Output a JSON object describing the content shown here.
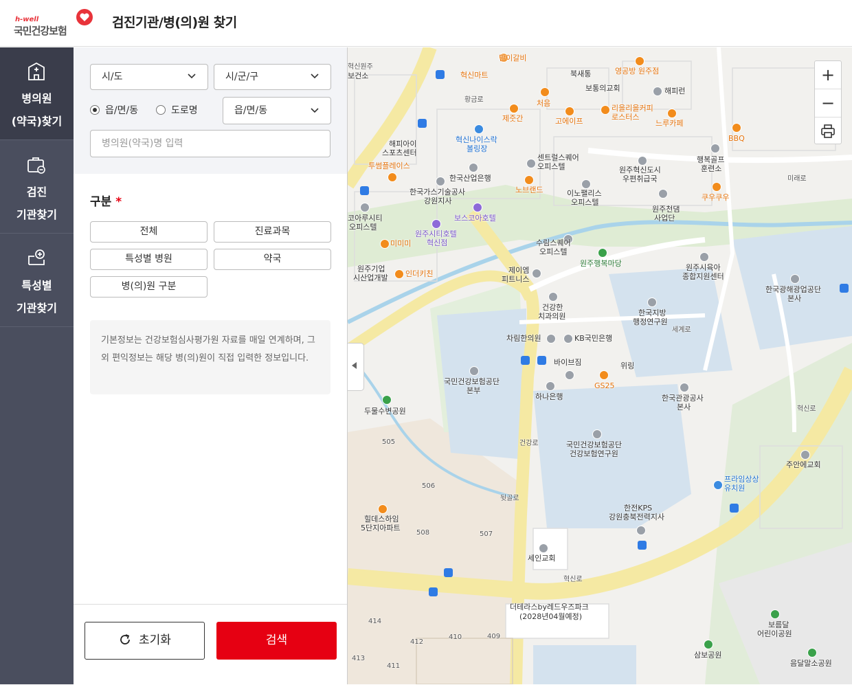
{
  "header": {
    "logo_small": "h-well",
    "logo_name": "국민건강보험",
    "title": "검진기관/병(의)원 찾기"
  },
  "nav": {
    "items": [
      {
        "label": "병의원\n(약국)찾기",
        "line1": "병의원",
        "line2": "(약국)찾기",
        "icon": "hospital-icon",
        "active": true
      },
      {
        "label": "검진\n기관찾기",
        "line1": "검진",
        "line2": "기관찾기",
        "icon": "medical-bag-icon",
        "active": false
      },
      {
        "label": "특성별\n기관찾기",
        "line1": "특성별",
        "line2": "기관찾기",
        "icon": "special-clinic-icon",
        "active": false
      }
    ]
  },
  "filters": {
    "sido": "시/도",
    "sigungu": "시/군/구",
    "radio_eup": "읍/면/동",
    "radio_road": "도로명",
    "eup_select": "읍/면/동",
    "name_placeholder": "병의원(약국)명 입력"
  },
  "category": {
    "title": "구분",
    "required_mark": "*",
    "chips": [
      "전체",
      "진료과목",
      "특성별 병원",
      "약국",
      "병(의)원 구분"
    ]
  },
  "info_text": "기본정보는 건강보험심사평가원 자료를 매일 연계하며, 그 외 편익정보는 해당 병(의)원이 직접 입력한 정보입니다.",
  "actions": {
    "reset": "초기화",
    "search": "검색"
  },
  "map": {
    "labels": [
      "만이갈비",
      "혁신마트",
      "혁신원주",
      "보건소",
      "북새통",
      "보통의교회",
      "영공방 원주점",
      "해피런",
      "처음",
      "제줏간",
      "고에이프",
      "리을리을커피",
      "로스터스",
      "느루카페",
      "BBQ",
      "황금로",
      "혁신나이스락",
      "볼링장",
      "해피아이",
      "스포츠센터",
      "투썸플레이스",
      "한국산업은행",
      "한국가스기술공사",
      "강원지사",
      "센트럴스퀘어",
      "오피스텔",
      "노브랜드",
      "이노팰리스",
      "오피스텔",
      "원주혁신도시",
      "우편취급국",
      "행복골프",
      "훈련소",
      "쿠우쿠우",
      "원주천댐",
      "사업단",
      "미래로",
      "보스코아호텔",
      "코아루시티",
      "오피스텔",
      "원주시티호텔",
      "혁신점",
      "미미미",
      "원주기업",
      "시산업개발",
      "인더키친",
      "수림스퀘어",
      "오피스텔",
      "원주행복마당",
      "제이엠",
      "피트니스",
      "원주시육아",
      "종합지원센터",
      "한국광해광업공단",
      "본사",
      "건강한",
      "치과의원",
      "한국지방",
      "행정연구원",
      "차림한의원",
      "KB국민은행",
      "세계로",
      "국민건강보험공단",
      "본부",
      "바이브짐",
      "위링",
      "GS25",
      "하나은행",
      "한국관광공사",
      "본사",
      "두물수변공원",
      "혁신로",
      "주안에교회",
      "국민건강보험공단",
      "건강보험연구원",
      "건강로",
      "프라임상상",
      "유치원",
      "한전KPS",
      "강원충북전력지사",
      "힐데스하임",
      "5단지아파트",
      "뒷골로",
      "세인교회",
      "혁신로",
      "더테라스by레드우즈파크",
      "(2028년04월예정)",
      "보름달",
      "어린이공원",
      "삼보공원",
      "음달말소공원"
    ],
    "numbers": [
      "505",
      "506",
      "507",
      "508",
      "409",
      "410",
      "412",
      "414",
      "411",
      "413"
    ],
    "zoom_in": "+",
    "zoom_out": "−",
    "print_icon": "printer-icon"
  }
}
